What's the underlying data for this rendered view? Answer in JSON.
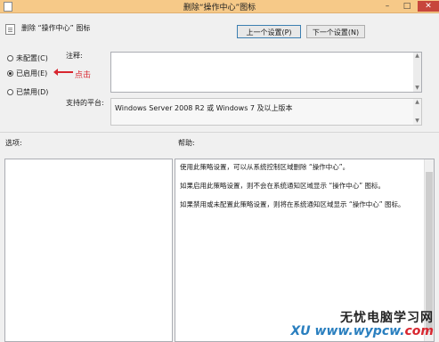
{
  "window": {
    "title": "删除“操作中心”图标",
    "minimize": "–",
    "maximize": "□",
    "close": "✕"
  },
  "policy": {
    "name": "删除 “操作中心” 图标"
  },
  "buttons": {
    "prev": "上一个设置(P)",
    "next": "下一个设置(N)"
  },
  "radios": [
    {
      "label": "未配置(C)",
      "selected": false
    },
    {
      "label": "已启用(E)",
      "selected": true
    },
    {
      "label": "已禁用(D)",
      "selected": false
    }
  ],
  "annotation": {
    "text": "点击",
    "color": "#d8262f"
  },
  "comment": {
    "label": "注释:",
    "value": ""
  },
  "platform": {
    "label": "支持的平台:",
    "value": "Windows Server 2008 R2 或 Windows 7 及以上版本"
  },
  "options": {
    "label": "选项:"
  },
  "help": {
    "label": "帮助:",
    "paragraphs": [
      "使用此策略设置，可以从系统控制区域删除 “操作中心”。",
      "如果启用此策略设置，则不会在系统通知区域显示 “操作中心” 图标。",
      "如果禁用或未配置此策略设置，则将在系统通知区域显示 “操作中心” 图标。"
    ]
  },
  "watermark": {
    "line1": "无忧电脑学习网",
    "line2_a": "www.wypcw.",
    "line2_b": "com",
    "line2_prefix": "XU"
  }
}
